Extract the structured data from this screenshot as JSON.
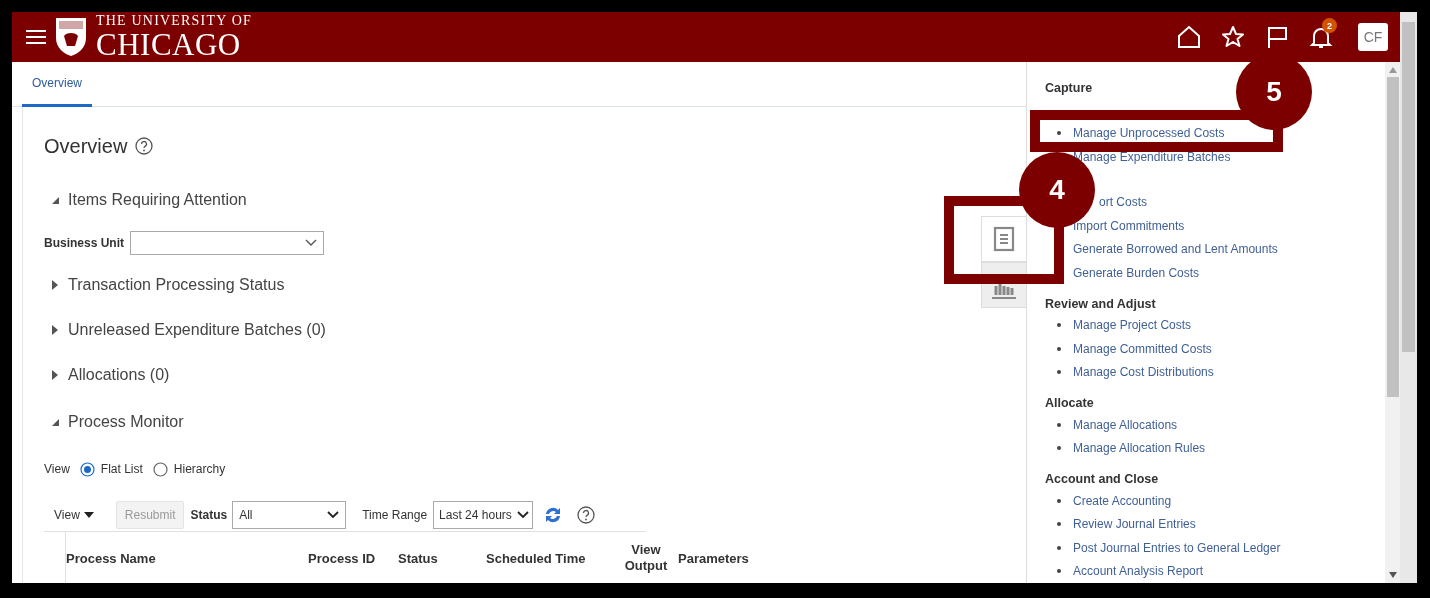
{
  "header": {
    "logo_line1": "THE UNIVERSITY OF",
    "logo_line2": "CHICAGO",
    "notification_count": "2",
    "user_initials": "CF"
  },
  "tabs": [
    {
      "label": "Overview",
      "selected": true
    }
  ],
  "page_title": "Overview",
  "attention": {
    "title": "Items Requiring Attention",
    "expanded": true,
    "business_unit_label": "Business Unit"
  },
  "groups": [
    {
      "title": "Transaction Processing Status",
      "expanded": false
    },
    {
      "title": "Unreleased Expenditure Batches (0)",
      "expanded": false
    },
    {
      "title": "Allocations (0)",
      "expanded": false
    }
  ],
  "monitor": {
    "title": "Process Monitor",
    "expanded": true,
    "view_label": "View",
    "radios": [
      {
        "label": "Flat List",
        "selected": true
      },
      {
        "label": "Hierarchy",
        "selected": false
      }
    ],
    "toolbar": {
      "view_menu": "View",
      "resubmit": "Resubmit",
      "resubmit_disabled": true,
      "status_label": "Status",
      "status_value": "All",
      "time_label": "Time Range",
      "time_value": "Last 24 hours"
    },
    "columns": [
      "Process Name",
      "Process ID",
      "Status",
      "Scheduled Time",
      "View Output",
      "Parameters"
    ]
  },
  "panel_tabs": [
    {
      "kind": "document",
      "selected": true
    },
    {
      "kind": "chart",
      "selected": false
    }
  ],
  "task_sections": [
    {
      "heading": "Capture",
      "items": [
        {
          "label": "Manage Unprocessed Costs",
          "kind": "link"
        },
        {
          "label": "Manage Expenditure Batches",
          "kind": "link"
        }
      ]
    },
    {
      "items": [
        {
          "label": "ort Costs",
          "kind": "partial"
        },
        {
          "label": "Import Commitments",
          "kind": "link"
        },
        {
          "label": "Generate Borrowed and Lent Amounts",
          "kind": "link"
        },
        {
          "label": "Generate Burden Costs",
          "kind": "link"
        }
      ]
    },
    {
      "heading": "Review and Adjust",
      "items": [
        {
          "label": "Manage Project Costs",
          "kind": "link"
        },
        {
          "label": "Manage Committed Costs",
          "kind": "link"
        },
        {
          "label": "Manage Cost Distributions",
          "kind": "link"
        }
      ]
    },
    {
      "heading": "Allocate",
      "items": [
        {
          "label": "Manage Allocations",
          "kind": "link"
        },
        {
          "label": "Manage Allocation Rules",
          "kind": "link"
        }
      ]
    },
    {
      "heading": "Account and Close",
      "items": [
        {
          "label": "Create Accounting",
          "kind": "link"
        },
        {
          "label": "Review Journal Entries",
          "kind": "link"
        },
        {
          "label": "Post Journal Entries to General Ledger",
          "kind": "link"
        },
        {
          "label": "Account Analysis Report",
          "kind": "link"
        }
      ]
    }
  ],
  "callouts": [
    {
      "number": "5"
    },
    {
      "number": "4"
    }
  ]
}
